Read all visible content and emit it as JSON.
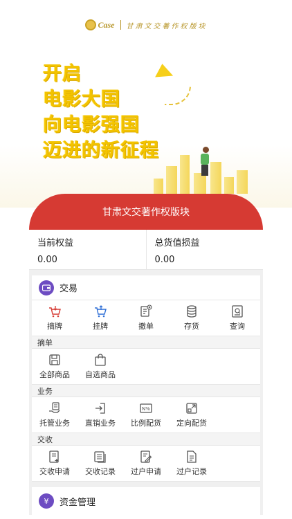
{
  "brand": {
    "logo_word": "Case",
    "logo_text": "甘肃文交著作权版块"
  },
  "hero": {
    "slogan": [
      "开启",
      "电影大国",
      "向电影强国",
      "迈进的新征程"
    ]
  },
  "card": {
    "title": "甘肃文交著作权版块",
    "balances": [
      {
        "label": "当前权益",
        "value": "0.00"
      },
      {
        "label": "总货值损益",
        "value": "0.00"
      }
    ]
  },
  "trade": {
    "title": "交易",
    "actions": [
      {
        "label": "摘牌",
        "icon": "cart-down-icon"
      },
      {
        "label": "挂牌",
        "icon": "cart-up-icon"
      },
      {
        "label": "撤单",
        "icon": "document-cancel-icon"
      },
      {
        "label": "存货",
        "icon": "database-icon"
      },
      {
        "label": "查询",
        "icon": "search-document-icon"
      }
    ]
  },
  "sections": [
    {
      "header": "摘单",
      "items": [
        {
          "label": "全部商品",
          "icon": "save-icon"
        },
        {
          "label": "自选商品",
          "icon": "bag-icon"
        }
      ]
    },
    {
      "header": "业务",
      "items": [
        {
          "label": "托管业务",
          "icon": "hand-document-icon"
        },
        {
          "label": "直销业务",
          "icon": "login-icon"
        },
        {
          "label": "比例配货",
          "icon": "percent-icon"
        },
        {
          "label": "定向配货",
          "icon": "expand-icon"
        }
      ]
    },
    {
      "header": "交收",
      "items": [
        {
          "label": "交收申请",
          "icon": "doc-add-icon"
        },
        {
          "label": "交收记录",
          "icon": "records-icon"
        },
        {
          "label": "过户申请",
          "icon": "doc-edit-icon"
        },
        {
          "label": "过户记录",
          "icon": "doc-list-icon"
        }
      ]
    }
  ],
  "funds": {
    "title": "资金管理",
    "icon_glyph": "¥"
  },
  "colors": {
    "header_red": "#d63a33",
    "accent_purple": "#6d4cc2",
    "slogan_yellow": "#f3c300"
  }
}
